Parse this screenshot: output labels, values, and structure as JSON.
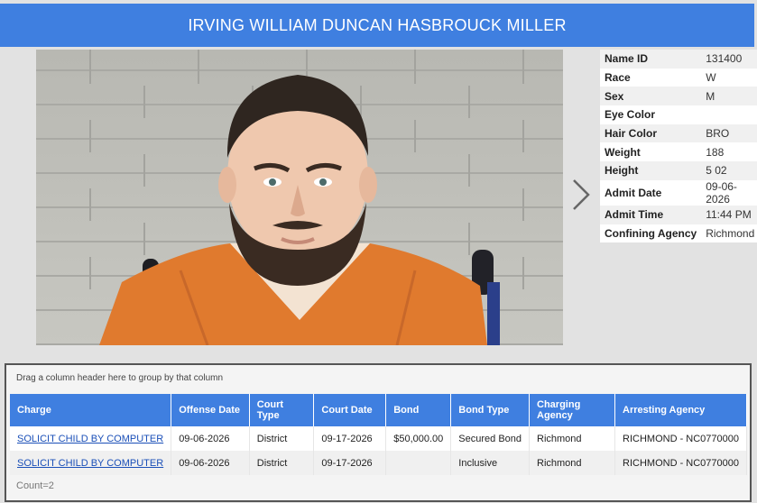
{
  "header": {
    "title": "IRVING WILLIAM DUNCAN HASBROUCK MILLER"
  },
  "photo": {
    "alt": "mugshot"
  },
  "details": [
    {
      "label": "Name ID",
      "value": "131400"
    },
    {
      "label": "Race",
      "value": "W"
    },
    {
      "label": "Sex",
      "value": "M"
    },
    {
      "label": "Eye Color",
      "value": ""
    },
    {
      "label": "Hair Color",
      "value": "BRO"
    },
    {
      "label": "Weight",
      "value": "188"
    },
    {
      "label": "Height",
      "value": "5 02"
    },
    {
      "label": "Admit Date",
      "value": "09-06-2026"
    },
    {
      "label": "Admit Time",
      "value": "11:44 PM"
    },
    {
      "label": "Confining Agency",
      "value": "Richmond"
    }
  ],
  "grid": {
    "group_hint": "Drag a column header here to group by that column",
    "columns": [
      "Charge",
      "Offense Date",
      "Court Type",
      "Court Date",
      "Bond",
      "Bond Type",
      "Charging Agency",
      "Arresting Agency"
    ],
    "rows": [
      {
        "charge": "SOLICIT CHILD BY COMPUTER",
        "offense_date": "09-06-2026",
        "court_type": "District",
        "court_date": "09-17-2026",
        "bond": "$50,000.00",
        "bond_type": "Secured Bond",
        "charging_agency": "Richmond",
        "arresting_agency": "RICHMOND - NC0770000"
      },
      {
        "charge": "SOLICIT CHILD BY COMPUTER",
        "offense_date": "09-06-2026",
        "court_type": "District",
        "court_date": "09-17-2026",
        "bond": "",
        "bond_type": "Inclusive",
        "charging_agency": "Richmond",
        "arresting_agency": "RICHMOND - NC0770000"
      }
    ],
    "count": "Count=2"
  },
  "colors": {
    "accent": "#3f7fe0",
    "link": "#1a4fb8",
    "jumpsuit": "#e07a2e"
  },
  "icons": {
    "next": "chevron-right-icon"
  }
}
